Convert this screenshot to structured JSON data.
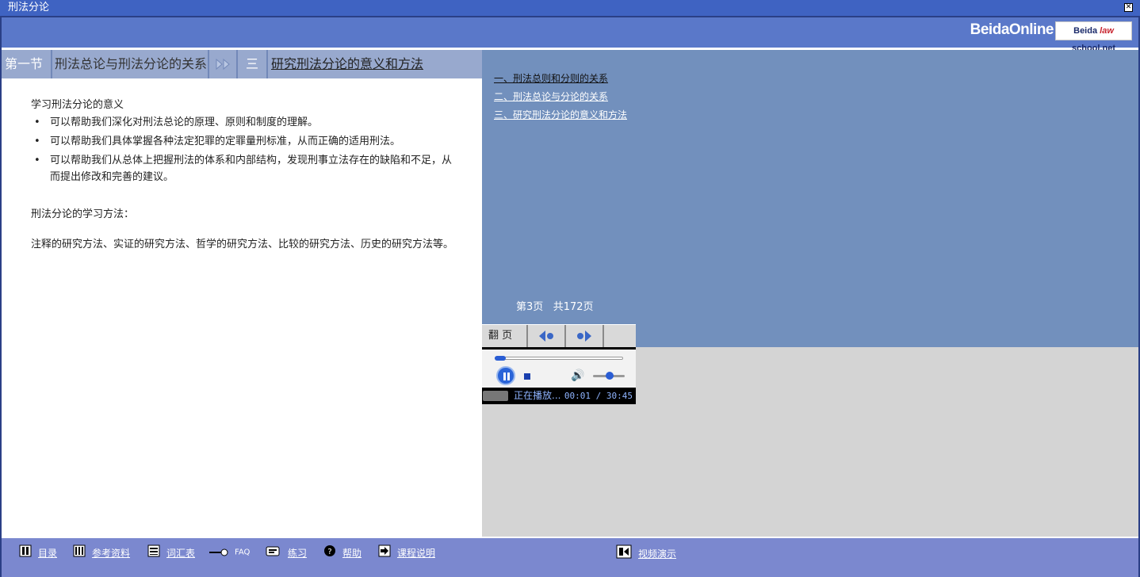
{
  "window": {
    "title": "刑法分论"
  },
  "header": {
    "logo_online": "BeidaOnline",
    "logo_law": "Beida law school.net"
  },
  "section_bar": {
    "section": "第一节",
    "chapter": "刑法总论与刑法分论的关系",
    "number": "三",
    "topic": "研究刑法分论的意义和方法"
  },
  "content": {
    "heading": "学习刑法分论的意义",
    "bullets": [
      "可以帮助我们深化对刑法总论的原理、原则和制度的理解。",
      "可以帮助我们具体掌握各种法定犯罪的定罪量刑标准，从而正确的适用刑法。",
      "可以帮助我们从总体上把握刑法的体系和内部结构，发现刑事立法存在的缺陷和不足，从而提出修改和完善的建议。"
    ],
    "methods_title": "刑法分论的学习方法：",
    "methods_text": "注释的研究方法、实证的研究方法、哲学的研究方法、比较的研究方法、历史的研究方法等。"
  },
  "toc": {
    "items": [
      "一、刑法总则和分则的关系",
      "二、刑法总论与分论的关系",
      "三、研究刑法分论的意义和方法"
    ]
  },
  "pagination": {
    "current": "第3页",
    "total": "共172页",
    "flip_label": "翻 页"
  },
  "player": {
    "status": "正在播放...",
    "time": "00:01 / 30:45",
    "progress": 0.01
  },
  "footer": {
    "items": [
      {
        "label": "目录",
        "icon": "book-icon"
      },
      {
        "label": "参考资料",
        "icon": "bookshelf-icon"
      },
      {
        "label": "词汇表",
        "icon": "list-icon"
      },
      {
        "label": "FAQ",
        "icon": "key-icon"
      },
      {
        "label": "练习",
        "icon": "exercise-icon"
      },
      {
        "label": "帮助",
        "icon": "help-icon"
      },
      {
        "label": "课程说明",
        "icon": "arrow-right-icon"
      },
      {
        "label": "视频演示",
        "icon": "film-icon"
      }
    ]
  },
  "colors": {
    "header": "#5a78c9",
    "section_bar": "#98a9ce",
    "right_panel": "#7290bd",
    "footer": "#7b88cf",
    "player_accent": "#2a5dd4"
  }
}
